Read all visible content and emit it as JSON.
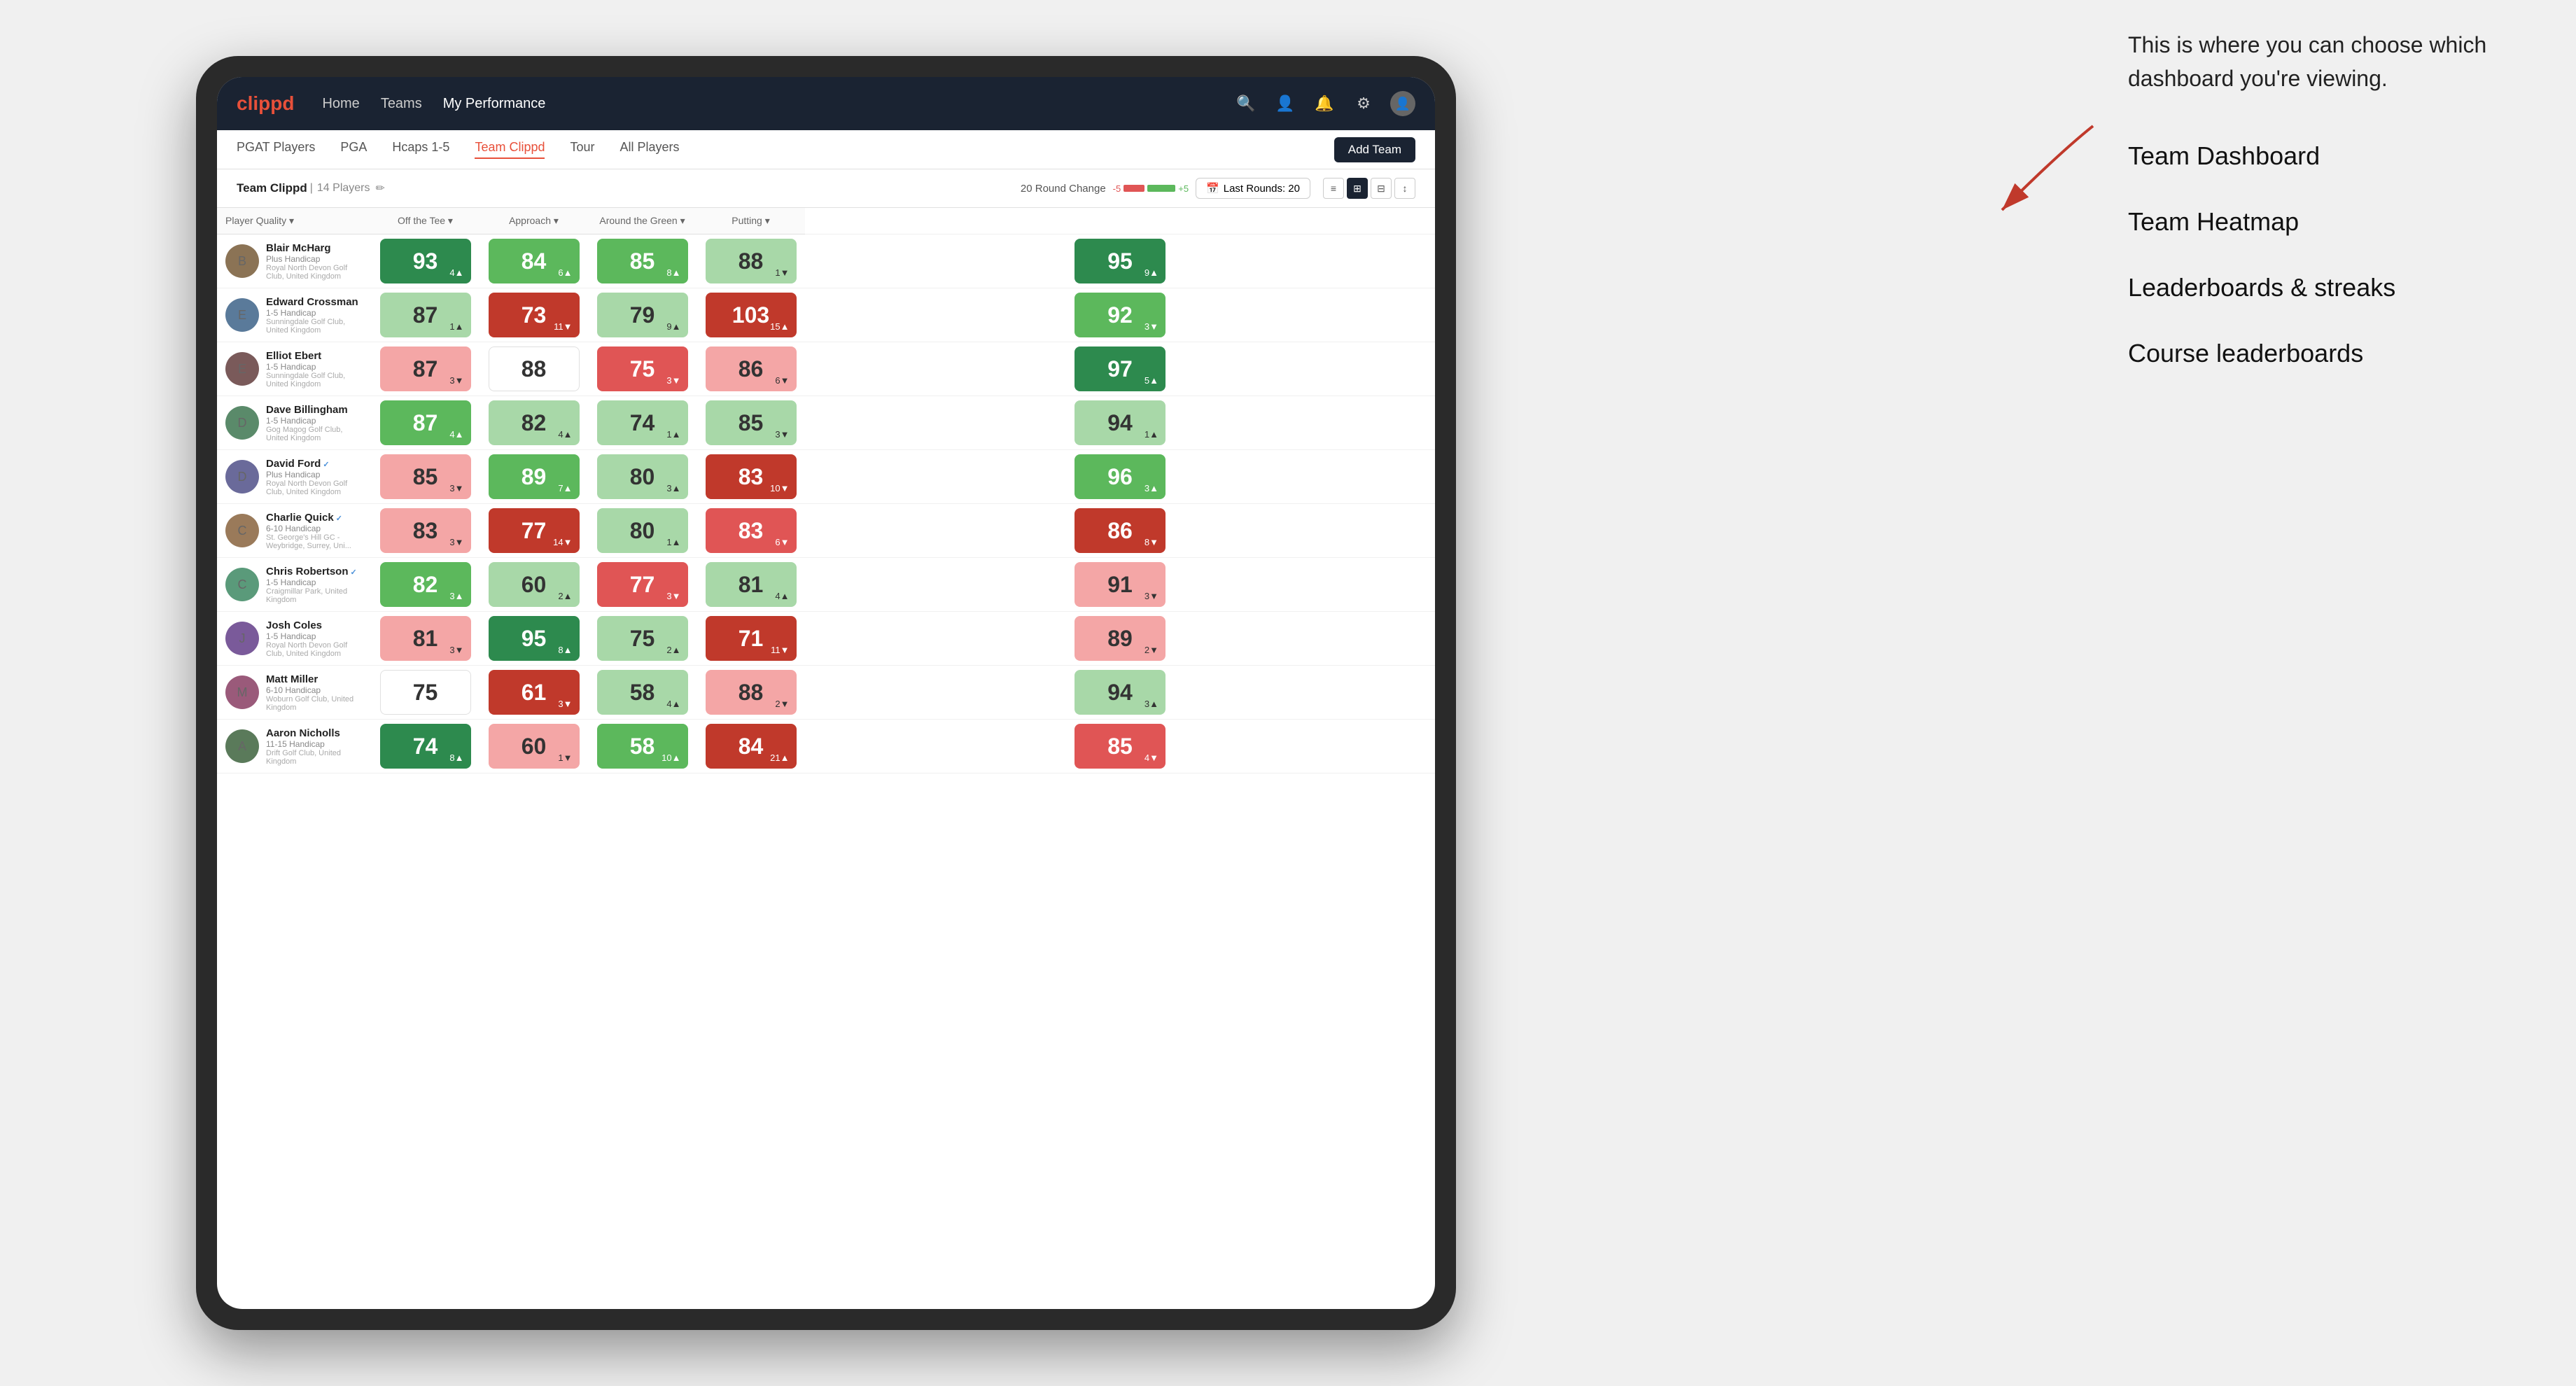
{
  "annotation": {
    "intro": "This is where you can choose which dashboard you're viewing.",
    "items": [
      "Team Dashboard",
      "Team Heatmap",
      "Leaderboards & streaks",
      "Course leaderboards"
    ]
  },
  "nav": {
    "logo": "clippd",
    "links": [
      "Home",
      "Teams",
      "My Performance"
    ],
    "active_link": "My Performance"
  },
  "sub_nav": {
    "links": [
      "PGAT Players",
      "PGA",
      "Hcaps 1-5",
      "Team Clippd",
      "Tour",
      "All Players"
    ],
    "active_link": "Team Clippd",
    "add_team_label": "Add Team"
  },
  "team_header": {
    "team_name": "Team Clippd",
    "team_count": "14 Players",
    "round_change_label": "20 Round Change",
    "round_change_low": "-5",
    "round_change_high": "+5",
    "last_rounds_label": "Last Rounds: 20"
  },
  "columns": {
    "player_quality": "Player Quality ▾",
    "off_tee": "Off the Tee ▾",
    "approach": "Approach ▾",
    "around_green": "Around the Green ▾",
    "putting": "Putting ▾"
  },
  "players": [
    {
      "name": "Blair McHarg",
      "handicap": "Plus Handicap",
      "club": "Royal North Devon Golf Club, United Kingdom",
      "scores": {
        "player_quality": {
          "value": 93,
          "change": "+4",
          "dir": "up",
          "color": "bg-dark-green"
        },
        "off_tee": {
          "value": 84,
          "change": "+6",
          "dir": "up",
          "color": "bg-med-green"
        },
        "approach": {
          "value": 85,
          "change": "+8",
          "dir": "up",
          "color": "bg-med-green"
        },
        "around_green": {
          "value": 88,
          "change": "-1",
          "dir": "down",
          "color": "bg-light-green"
        },
        "putting": {
          "value": 95,
          "change": "+9",
          "dir": "up",
          "color": "bg-dark-green"
        }
      }
    },
    {
      "name": "Edward Crossman",
      "handicap": "1-5 Handicap",
      "club": "Sunningdale Golf Club, United Kingdom",
      "scores": {
        "player_quality": {
          "value": 87,
          "change": "+1",
          "dir": "up",
          "color": "bg-light-green"
        },
        "off_tee": {
          "value": 73,
          "change": "-11",
          "dir": "down",
          "color": "bg-dark-red"
        },
        "approach": {
          "value": 79,
          "change": "+9",
          "dir": "up",
          "color": "bg-light-green"
        },
        "around_green": {
          "value": 103,
          "change": "+15",
          "dir": "up",
          "color": "bg-dark-red"
        },
        "putting": {
          "value": 92,
          "change": "-3",
          "dir": "down",
          "color": "bg-med-green"
        }
      }
    },
    {
      "name": "Elliot Ebert",
      "handicap": "1-5 Handicap",
      "club": "Sunningdale Golf Club, United Kingdom",
      "scores": {
        "player_quality": {
          "value": 87,
          "change": "-3",
          "dir": "down",
          "color": "bg-light-red"
        },
        "off_tee": {
          "value": 88,
          "change": "",
          "dir": "",
          "color": "bg-white"
        },
        "approach": {
          "value": 75,
          "change": "-3",
          "dir": "down",
          "color": "bg-med-red"
        },
        "around_green": {
          "value": 86,
          "change": "-6",
          "dir": "down",
          "color": "bg-light-red"
        },
        "putting": {
          "value": 97,
          "change": "+5",
          "dir": "up",
          "color": "bg-dark-green"
        }
      }
    },
    {
      "name": "Dave Billingham",
      "handicap": "1-5 Handicap",
      "club": "Gog Magog Golf Club, United Kingdom",
      "scores": {
        "player_quality": {
          "value": 87,
          "change": "+4",
          "dir": "up",
          "color": "bg-med-green"
        },
        "off_tee": {
          "value": 82,
          "change": "+4",
          "dir": "up",
          "color": "bg-light-green"
        },
        "approach": {
          "value": 74,
          "change": "+1",
          "dir": "up",
          "color": "bg-light-green"
        },
        "around_green": {
          "value": 85,
          "change": "-3",
          "dir": "down",
          "color": "bg-light-green"
        },
        "putting": {
          "value": 94,
          "change": "+1",
          "dir": "up",
          "color": "bg-light-green"
        }
      }
    },
    {
      "name": "David Ford",
      "handicap": "Plus Handicap",
      "club": "Royal North Devon Golf Club, United Kingdom",
      "verified": true,
      "scores": {
        "player_quality": {
          "value": 85,
          "change": "-3",
          "dir": "down",
          "color": "bg-light-red"
        },
        "off_tee": {
          "value": 89,
          "change": "+7",
          "dir": "up",
          "color": "bg-med-green"
        },
        "approach": {
          "value": 80,
          "change": "+3",
          "dir": "up",
          "color": "bg-light-green"
        },
        "around_green": {
          "value": 83,
          "change": "-10",
          "dir": "down",
          "color": "bg-dark-red"
        },
        "putting": {
          "value": 96,
          "change": "+3",
          "dir": "up",
          "color": "bg-med-green"
        }
      }
    },
    {
      "name": "Charlie Quick",
      "handicap": "6-10 Handicap",
      "club": "St. George's Hill GC - Weybridge, Surrey, Uni...",
      "verified": true,
      "scores": {
        "player_quality": {
          "value": 83,
          "change": "-3",
          "dir": "down",
          "color": "bg-light-red"
        },
        "off_tee": {
          "value": 77,
          "change": "-14",
          "dir": "down",
          "color": "bg-dark-red"
        },
        "approach": {
          "value": 80,
          "change": "+1",
          "dir": "up",
          "color": "bg-light-green"
        },
        "around_green": {
          "value": 83,
          "change": "-6",
          "dir": "down",
          "color": "bg-med-red"
        },
        "putting": {
          "value": 86,
          "change": "-8",
          "dir": "down",
          "color": "bg-dark-red"
        }
      }
    },
    {
      "name": "Chris Robertson",
      "handicap": "1-5 Handicap",
      "club": "Craigmillar Park, United Kingdom",
      "verified": true,
      "scores": {
        "player_quality": {
          "value": 82,
          "change": "+3",
          "dir": "up",
          "color": "bg-med-green"
        },
        "off_tee": {
          "value": 60,
          "change": "+2",
          "dir": "up",
          "color": "bg-light-green"
        },
        "approach": {
          "value": 77,
          "change": "-3",
          "dir": "down",
          "color": "bg-med-red"
        },
        "around_green": {
          "value": 81,
          "change": "+4",
          "dir": "up",
          "color": "bg-light-green"
        },
        "putting": {
          "value": 91,
          "change": "-3",
          "dir": "down",
          "color": "bg-light-red"
        }
      }
    },
    {
      "name": "Josh Coles",
      "handicap": "1-5 Handicap",
      "club": "Royal North Devon Golf Club, United Kingdom",
      "scores": {
        "player_quality": {
          "value": 81,
          "change": "-3",
          "dir": "down",
          "color": "bg-light-red"
        },
        "off_tee": {
          "value": 95,
          "change": "+8",
          "dir": "up",
          "color": "bg-dark-green"
        },
        "approach": {
          "value": 75,
          "change": "+2",
          "dir": "up",
          "color": "bg-light-green"
        },
        "around_green": {
          "value": 71,
          "change": "-11",
          "dir": "down",
          "color": "bg-dark-red"
        },
        "putting": {
          "value": 89,
          "change": "-2",
          "dir": "down",
          "color": "bg-light-red"
        }
      }
    },
    {
      "name": "Matt Miller",
      "handicap": "6-10 Handicap",
      "club": "Woburn Golf Club, United Kingdom",
      "scores": {
        "player_quality": {
          "value": 75,
          "change": "",
          "dir": "",
          "color": "bg-white"
        },
        "off_tee": {
          "value": 61,
          "change": "-3",
          "dir": "down",
          "color": "bg-dark-red"
        },
        "approach": {
          "value": 58,
          "change": "+4",
          "dir": "up",
          "color": "bg-light-green"
        },
        "around_green": {
          "value": 88,
          "change": "-2",
          "dir": "down",
          "color": "bg-light-red"
        },
        "putting": {
          "value": 94,
          "change": "+3",
          "dir": "up",
          "color": "bg-light-green"
        }
      }
    },
    {
      "name": "Aaron Nicholls",
      "handicap": "11-15 Handicap",
      "club": "Drift Golf Club, United Kingdom",
      "scores": {
        "player_quality": {
          "value": 74,
          "change": "+8",
          "dir": "up",
          "color": "bg-dark-green"
        },
        "off_tee": {
          "value": 60,
          "change": "-1",
          "dir": "down",
          "color": "bg-light-red"
        },
        "approach": {
          "value": 58,
          "change": "+10",
          "dir": "up",
          "color": "bg-med-green"
        },
        "around_green": {
          "value": 84,
          "change": "+21",
          "dir": "up",
          "color": "bg-dark-red"
        },
        "putting": {
          "value": 85,
          "change": "-4",
          "dir": "down",
          "color": "bg-med-red"
        }
      }
    }
  ],
  "colors": {
    "dark_green": "#2d8a4e",
    "med_green": "#5cb85c",
    "light_green": "#a8d8a8",
    "white": "#ffffff",
    "light_red": "#f4a6a6",
    "med_red": "#e05555",
    "dark_red": "#c0392b",
    "nav_bg": "#1a2332",
    "accent": "#e8503a"
  }
}
